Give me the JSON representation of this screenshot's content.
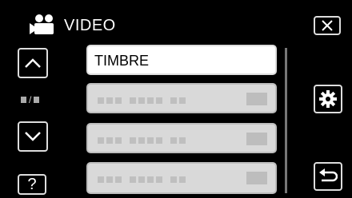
{
  "header": {
    "title": "VIDEO",
    "mode_icon": "video-camera-icon"
  },
  "controls": {
    "close_icon": "close-icon",
    "up_icon": "chevron-up-icon",
    "down_icon": "chevron-down-icon",
    "help_label": "?",
    "page_indicator": "■/■",
    "settings_icon": "gear-icon",
    "back_icon": "return-icon"
  },
  "menu": {
    "items": [
      {
        "label": "TIMBRE",
        "state": "selected"
      },
      {
        "label": "",
        "state": "placeholder"
      },
      {
        "label": "",
        "state": "placeholder"
      },
      {
        "label": "",
        "state": "placeholder"
      }
    ]
  },
  "colors": {
    "background": "#000000",
    "item_active": "#ffffff",
    "item_placeholder": "#d9d9d9"
  }
}
